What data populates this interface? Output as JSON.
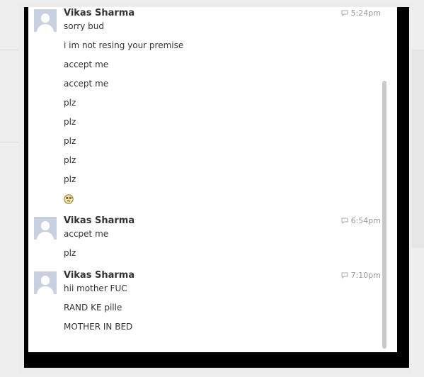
{
  "conversation": {
    "groups": [
      {
        "author": "Vikas Sharma",
        "time": "5:24pm",
        "messages": [
          "sorry bud",
          "i im not resing your premise",
          "accept me",
          "accept me",
          "plz",
          "plz",
          "plz",
          "plz",
          "plz"
        ],
        "emoji": "confused-emoticon"
      },
      {
        "author": "Vikas Sharma",
        "time": "6:54pm",
        "messages": [
          "accpet me",
          "plz"
        ]
      },
      {
        "author": "Vikas Sharma",
        "time": "7:10pm",
        "messages": [
          "hii mother FUC",
          "RAND KE pille",
          "MOTHER IN BED"
        ]
      }
    ]
  },
  "icons": {
    "timestamp": "chat-bubble-icon",
    "avatar": "default-avatar-icon"
  },
  "colors": {
    "popup_frame": "#000000",
    "panel_bg": "#ffffff",
    "author_text": "#333333",
    "timestamp_text": "#999999",
    "avatar_bg": "#c9d1e0"
  }
}
